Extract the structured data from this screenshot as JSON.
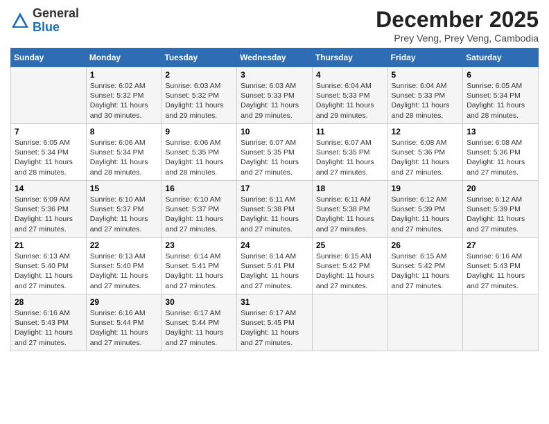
{
  "logo": {
    "general": "General",
    "blue": "Blue"
  },
  "header": {
    "month": "December 2025",
    "location": "Prey Veng, Prey Veng, Cambodia"
  },
  "days_of_week": [
    "Sunday",
    "Monday",
    "Tuesday",
    "Wednesday",
    "Thursday",
    "Friday",
    "Saturday"
  ],
  "weeks": [
    [
      {
        "day": "",
        "info": ""
      },
      {
        "day": "1",
        "info": "Sunrise: 6:02 AM\nSunset: 5:32 PM\nDaylight: 11 hours\nand 30 minutes."
      },
      {
        "day": "2",
        "info": "Sunrise: 6:03 AM\nSunset: 5:32 PM\nDaylight: 11 hours\nand 29 minutes."
      },
      {
        "day": "3",
        "info": "Sunrise: 6:03 AM\nSunset: 5:33 PM\nDaylight: 11 hours\nand 29 minutes."
      },
      {
        "day": "4",
        "info": "Sunrise: 6:04 AM\nSunset: 5:33 PM\nDaylight: 11 hours\nand 29 minutes."
      },
      {
        "day": "5",
        "info": "Sunrise: 6:04 AM\nSunset: 5:33 PM\nDaylight: 11 hours\nand 28 minutes."
      },
      {
        "day": "6",
        "info": "Sunrise: 6:05 AM\nSunset: 5:34 PM\nDaylight: 11 hours\nand 28 minutes."
      }
    ],
    [
      {
        "day": "7",
        "info": "Sunrise: 6:05 AM\nSunset: 5:34 PM\nDaylight: 11 hours\nand 28 minutes."
      },
      {
        "day": "8",
        "info": "Sunrise: 6:06 AM\nSunset: 5:34 PM\nDaylight: 11 hours\nand 28 minutes."
      },
      {
        "day": "9",
        "info": "Sunrise: 6:06 AM\nSunset: 5:35 PM\nDaylight: 11 hours\nand 28 minutes."
      },
      {
        "day": "10",
        "info": "Sunrise: 6:07 AM\nSunset: 5:35 PM\nDaylight: 11 hours\nand 27 minutes."
      },
      {
        "day": "11",
        "info": "Sunrise: 6:07 AM\nSunset: 5:35 PM\nDaylight: 11 hours\nand 27 minutes."
      },
      {
        "day": "12",
        "info": "Sunrise: 6:08 AM\nSunset: 5:36 PM\nDaylight: 11 hours\nand 27 minutes."
      },
      {
        "day": "13",
        "info": "Sunrise: 6:08 AM\nSunset: 5:36 PM\nDaylight: 11 hours\nand 27 minutes."
      }
    ],
    [
      {
        "day": "14",
        "info": "Sunrise: 6:09 AM\nSunset: 5:36 PM\nDaylight: 11 hours\nand 27 minutes."
      },
      {
        "day": "15",
        "info": "Sunrise: 6:10 AM\nSunset: 5:37 PM\nDaylight: 11 hours\nand 27 minutes."
      },
      {
        "day": "16",
        "info": "Sunrise: 6:10 AM\nSunset: 5:37 PM\nDaylight: 11 hours\nand 27 minutes."
      },
      {
        "day": "17",
        "info": "Sunrise: 6:11 AM\nSunset: 5:38 PM\nDaylight: 11 hours\nand 27 minutes."
      },
      {
        "day": "18",
        "info": "Sunrise: 6:11 AM\nSunset: 5:38 PM\nDaylight: 11 hours\nand 27 minutes."
      },
      {
        "day": "19",
        "info": "Sunrise: 6:12 AM\nSunset: 5:39 PM\nDaylight: 11 hours\nand 27 minutes."
      },
      {
        "day": "20",
        "info": "Sunrise: 6:12 AM\nSunset: 5:39 PM\nDaylight: 11 hours\nand 27 minutes."
      }
    ],
    [
      {
        "day": "21",
        "info": "Sunrise: 6:13 AM\nSunset: 5:40 PM\nDaylight: 11 hours\nand 27 minutes."
      },
      {
        "day": "22",
        "info": "Sunrise: 6:13 AM\nSunset: 5:40 PM\nDaylight: 11 hours\nand 27 minutes."
      },
      {
        "day": "23",
        "info": "Sunrise: 6:14 AM\nSunset: 5:41 PM\nDaylight: 11 hours\nand 27 minutes."
      },
      {
        "day": "24",
        "info": "Sunrise: 6:14 AM\nSunset: 5:41 PM\nDaylight: 11 hours\nand 27 minutes."
      },
      {
        "day": "25",
        "info": "Sunrise: 6:15 AM\nSunset: 5:42 PM\nDaylight: 11 hours\nand 27 minutes."
      },
      {
        "day": "26",
        "info": "Sunrise: 6:15 AM\nSunset: 5:42 PM\nDaylight: 11 hours\nand 27 minutes."
      },
      {
        "day": "27",
        "info": "Sunrise: 6:16 AM\nSunset: 5:43 PM\nDaylight: 11 hours\nand 27 minutes."
      }
    ],
    [
      {
        "day": "28",
        "info": "Sunrise: 6:16 AM\nSunset: 5:43 PM\nDaylight: 11 hours\nand 27 minutes."
      },
      {
        "day": "29",
        "info": "Sunrise: 6:16 AM\nSunset: 5:44 PM\nDaylight: 11 hours\nand 27 minutes."
      },
      {
        "day": "30",
        "info": "Sunrise: 6:17 AM\nSunset: 5:44 PM\nDaylight: 11 hours\nand 27 minutes."
      },
      {
        "day": "31",
        "info": "Sunrise: 6:17 AM\nSunset: 5:45 PM\nDaylight: 11 hours\nand 27 minutes."
      },
      {
        "day": "",
        "info": ""
      },
      {
        "day": "",
        "info": ""
      },
      {
        "day": "",
        "info": ""
      }
    ]
  ]
}
